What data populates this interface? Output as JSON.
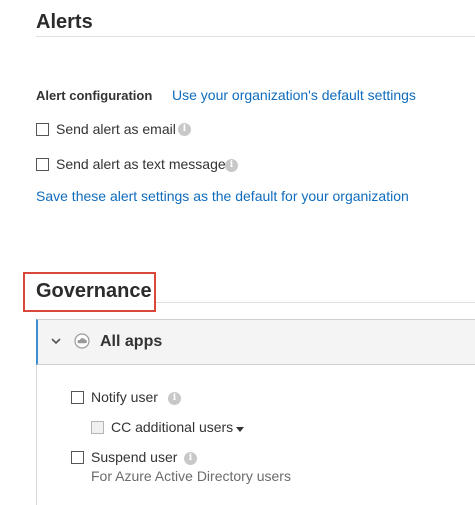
{
  "alerts": {
    "title": "Alerts",
    "config_label": "Alert configuration",
    "default_settings_link": "Use your organization's default settings",
    "email_label": "Send alert as email",
    "text_label": "Send alert as text message",
    "save_default_link": "Save these alert settings as the default for your organization"
  },
  "governance": {
    "title": "Governance",
    "highlight_color": "#d9483b",
    "panel": {
      "title": "All apps",
      "expand_icon": "chevron-down-icon",
      "app_icon": "cloud-icon"
    },
    "options": {
      "notify_label": "Notify user",
      "cc_label": "CC additional users",
      "suspend_label": "Suspend user",
      "suspend_sub": "For Azure Active Directory users"
    }
  },
  "colors": {
    "link": "#0f6cbd",
    "panel_accent": "#3c8fd4"
  }
}
